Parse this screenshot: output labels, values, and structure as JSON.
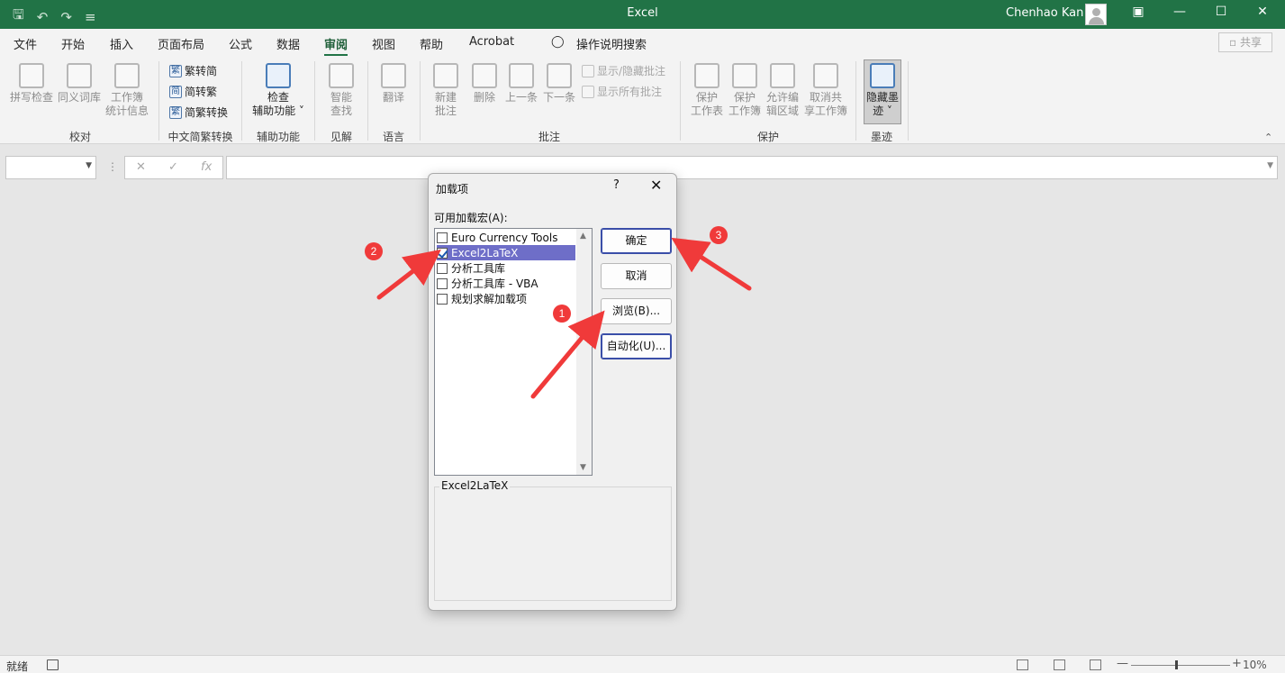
{
  "titlebar": {
    "title": "Excel",
    "user": "Chenhao Kan",
    "qat_icons": [
      "save-icon",
      "undo-icon",
      "redo-icon",
      "customize-icon"
    ]
  },
  "menu": {
    "tabs": [
      "文件",
      "开始",
      "插入",
      "页面布局",
      "公式",
      "数据",
      "审阅",
      "视图",
      "帮助",
      "Acrobat"
    ],
    "active": "审阅",
    "tell_me": "操作说明搜索",
    "share": "共享"
  },
  "ribbon": {
    "proofing": {
      "spelling": "拼写检查",
      "thesaurus": "同义词库",
      "stats_1": "工作簿",
      "stats_2": "统计信息",
      "group": "校对"
    },
    "chinese": {
      "t2s": "繁转简",
      "s2t": "简转繁",
      "convert": "简繁转换",
      "group": "中文简繁转换"
    },
    "access": {
      "check_1": "检查",
      "check_2": "辅助功能",
      "group": "辅助功能"
    },
    "insights": {
      "smart_1": "智能",
      "smart_2": "查找",
      "group": "见解"
    },
    "language": {
      "translate": "翻译",
      "group": "语言"
    },
    "comments": {
      "new_1": "新建",
      "new_2": "批注",
      "delete": "删除",
      "prev": "上一条",
      "next": "下一条",
      "show_hide": "显示/隐藏批注",
      "show_all": "显示所有批注",
      "group": "批注"
    },
    "protect": {
      "sheet_1": "保护",
      "sheet_2": "工作表",
      "wb_1": "保护",
      "wb_2": "工作簿",
      "ranges_1": "允许编",
      "ranges_2": "辑区域",
      "unshare_1": "取消共",
      "unshare_2": "享工作簿",
      "group": "保护"
    },
    "ink": {
      "hide_1": "隐藏墨",
      "hide_2": "迹",
      "group": "墨迹"
    }
  },
  "formula_bar": {
    "name_box": "",
    "formula": ""
  },
  "dialog": {
    "title": "加载项",
    "help": "?",
    "available_label": "可用加载宏(A):",
    "items": [
      {
        "label": "Euro Currency Tools",
        "checked": false
      },
      {
        "label": "Excel2LaTeX",
        "checked": true,
        "selected": true
      },
      {
        "label": "分析工具库",
        "checked": false
      },
      {
        "label": "分析工具库 - VBA",
        "checked": false
      },
      {
        "label": "规划求解加载项",
        "checked": false
      }
    ],
    "ok": "确定",
    "cancel": "取消",
    "browse": "浏览(B)...",
    "automation": "自动化(U)...",
    "description_title": "Excel2LaTeX"
  },
  "annotations": {
    "badges": [
      "1",
      "2",
      "3"
    ],
    "color": "#f03a3a"
  },
  "status": {
    "ready": "就绪",
    "zoom": "10%"
  },
  "colors": {
    "excel_green": "#217346",
    "selection": "#6e6ec8"
  }
}
